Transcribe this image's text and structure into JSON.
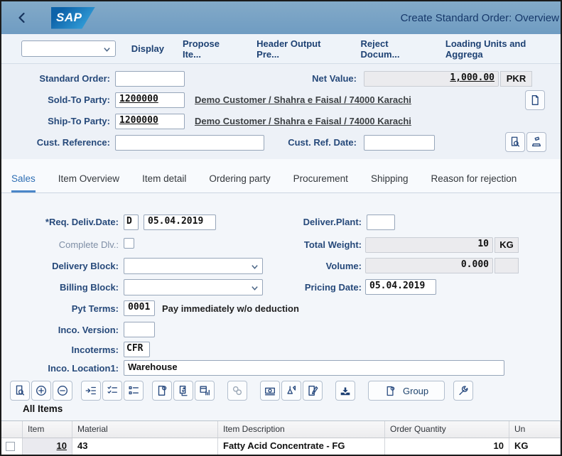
{
  "titlebar": {
    "logo_text": "SAP",
    "title": "Create Standard Order: Overview"
  },
  "menubar": {
    "dropdown_value": "",
    "items": [
      "Display",
      "Propose Ite...",
      "Header Output Pre...",
      "Reject Docum...",
      "Loading Units and Aggrega"
    ]
  },
  "header_form": {
    "standard_order_label": "Standard Order:",
    "standard_order_value": "",
    "net_value_label": "Net Value:",
    "net_value": "1,000.00",
    "currency": "PKR",
    "sold_to_label": "Sold-To Party:",
    "sold_to_value": "1200000",
    "sold_to_desc": "Demo Customer / Shahra e Faisal / 74000 Karachi",
    "ship_to_label": "Ship-To Party:",
    "ship_to_value": "1200000",
    "ship_to_desc": "Demo Customer / Shahra e Faisal / 74000 Karachi",
    "cust_ref_label": "Cust. Reference:",
    "cust_ref_value": "",
    "cust_ref_date_label": "Cust. Ref. Date:",
    "cust_ref_date_value": ""
  },
  "tabs": [
    {
      "label": "Sales",
      "active": true
    },
    {
      "label": "Item Overview",
      "active": false
    },
    {
      "label": "Item detail",
      "active": false
    },
    {
      "label": "Ordering party",
      "active": false
    },
    {
      "label": "Procurement",
      "active": false
    },
    {
      "label": "Shipping",
      "active": false
    },
    {
      "label": "Reason for rejection",
      "active": false
    }
  ],
  "sales": {
    "req_deliv_date_label": "*Req. Deliv.Date:",
    "req_deliv_date_type": "D",
    "req_deliv_date": "05.04.2019",
    "deliver_plant_label": "Deliver.Plant:",
    "deliver_plant": "",
    "complete_dlv_label": "Complete Dlv.:",
    "complete_dlv_checked": false,
    "total_weight_label": "Total Weight:",
    "total_weight": "10",
    "total_weight_unit": "KG",
    "delivery_block_label": "Delivery Block:",
    "delivery_block": "",
    "volume_label": "Volume:",
    "volume": "0.000",
    "volume_unit": "",
    "billing_block_label": "Billing Block:",
    "billing_block": "",
    "pricing_date_label": "Pricing Date:",
    "pricing_date": "05.04.2019",
    "pyt_terms_label": "Pyt Terms:",
    "pyt_terms": "0001",
    "pyt_terms_desc": "Pay immediately w/o deduction",
    "inco_version_label": "Inco. Version:",
    "inco_version": "",
    "incoterms_label": "Incoterms:",
    "incoterms": "CFR",
    "inco_location_label": "Inco. Location1:",
    "inco_location": "Warehouse"
  },
  "items_toolbar": {
    "group_label": "Group",
    "icons": [
      "item-detail-icon",
      "add-item-icon",
      "remove-item-icon",
      "insert-row-icon",
      "select-items-icon",
      "item-list-icon",
      "propose-items-icon",
      "copy-items-icon",
      "schedule-lines-icon",
      "link-icon",
      "pricing-icon",
      "configuration-icon",
      "edit-document-icon",
      "fast-entry-icon",
      "group-icon",
      "wrench-icon"
    ]
  },
  "items": {
    "section_label": "All Items",
    "columns": [
      "Item",
      "Material",
      "Item Description",
      "Order Quantity",
      "Un"
    ],
    "rows": [
      {
        "item": "10",
        "material": "43",
        "description": "Fatty Acid Concentrate - FG",
        "order_quantity": "10",
        "unit": "KG"
      }
    ]
  }
}
